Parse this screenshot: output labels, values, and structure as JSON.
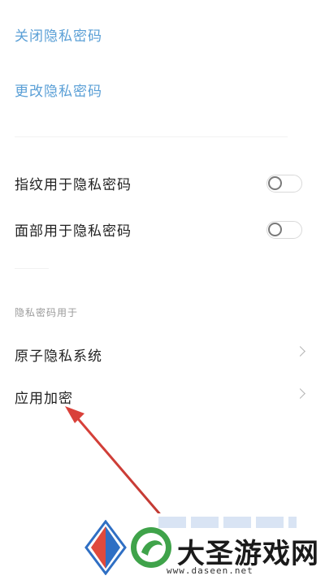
{
  "privacy": {
    "close_label": "关闭隐私密码",
    "change_label": "更改隐私密码"
  },
  "toggles": [
    {
      "label": "指纹用于隐私密码",
      "on": false
    },
    {
      "label": "面部用于隐私密码",
      "on": false
    }
  ],
  "section": {
    "header": "隐私密码用于",
    "items": [
      {
        "label": "原子隐私系统"
      },
      {
        "label": "应用加密"
      }
    ]
  },
  "watermark": {
    "title": "大圣游戏网",
    "url": "www.daseen.net"
  },
  "colors": {
    "link": "#5a9fd6",
    "text": "#222222",
    "annotation_arrow": "#d9413a"
  }
}
